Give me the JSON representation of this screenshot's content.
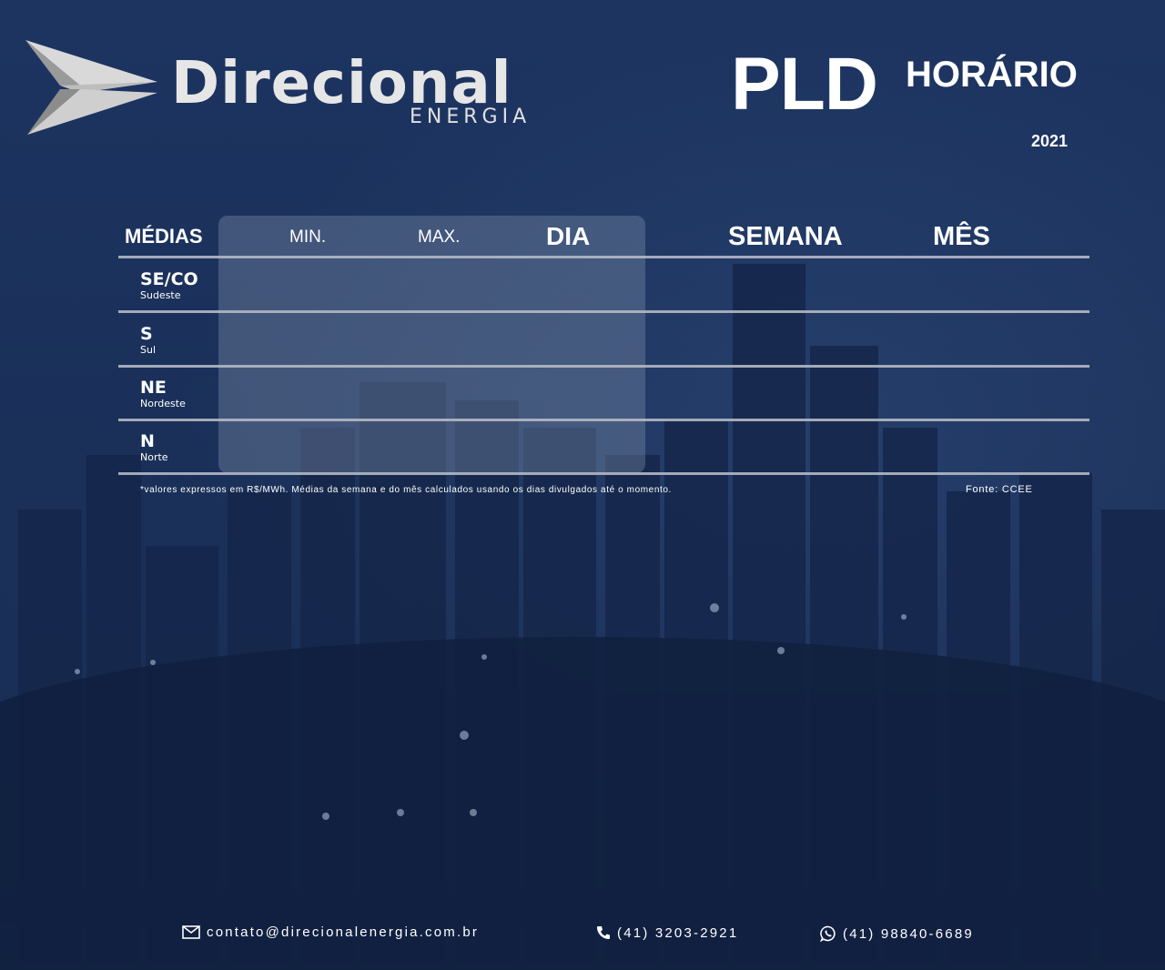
{
  "brand": {
    "wordmark": "Direcional",
    "subtitle": "ENERGIA"
  },
  "header": {
    "title_main": "PLD",
    "title_side": "HORÁRIO",
    "year": "2021"
  },
  "table": {
    "columns": {
      "medias": "MÉDIAS",
      "min": "MIN.",
      "max": "MAX.",
      "dia": "DIA",
      "semana": "SEMANA",
      "mes": "MÊS"
    },
    "regions": [
      {
        "code": "SE/CO",
        "name": "Sudeste"
      },
      {
        "code": "S",
        "name": "Sul"
      },
      {
        "code": "NE",
        "name": "Nordeste"
      },
      {
        "code": "N",
        "name": "Norte"
      }
    ],
    "note": "*valores expressos em R$/MWh. Médias da semana e do mês  calculados usando os dias divulgados até o momento.",
    "source": "Fonte: CCEE"
  },
  "footer": {
    "email": "contato@direcionalenergia.com.br",
    "phone": "(41) 3203-2921",
    "whatsapp": "(41) 98840-6689"
  },
  "colors": {
    "background": "#1b315a",
    "panel": "#6f7fa0",
    "rule": "#b3b8c3",
    "text": "#ffffff"
  }
}
